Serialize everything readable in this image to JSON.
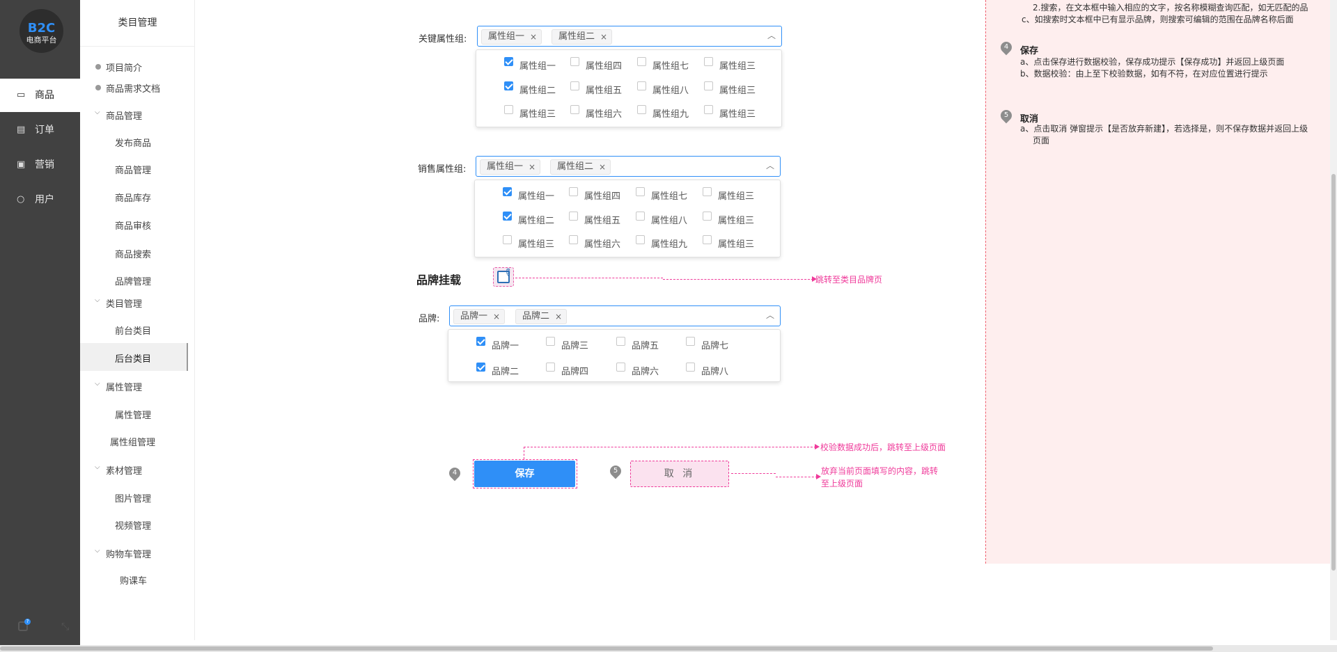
{
  "logo": {
    "main": "B2C",
    "sub": "电商平台"
  },
  "rail": {
    "items": [
      {
        "label": "商品",
        "icon": "bag-icon"
      },
      {
        "label": "订单",
        "icon": "order-icon"
      },
      {
        "label": "营销",
        "icon": "ticket-icon"
      },
      {
        "label": "用户",
        "icon": "user-icon"
      }
    ],
    "active": "商品",
    "badge": "?"
  },
  "menu": {
    "title": "类目管理",
    "doc_items": [
      "项目简介",
      "商品需求文档"
    ],
    "groups": [
      {
        "label": "商品管理",
        "items": [
          "发布商品",
          "商品管理",
          "商品库存",
          "商品审核",
          "商品搜索",
          "品牌管理"
        ]
      },
      {
        "label": "类目管理",
        "items": [
          "前台类目",
          "后台类目"
        ]
      },
      {
        "label": "属性管理",
        "items": [
          "属性管理",
          "属性组管理"
        ]
      },
      {
        "label": "素材管理",
        "items": [
          "图片管理",
          "视频管理"
        ]
      },
      {
        "label": "购物车管理",
        "items": [
          "购课车"
        ]
      }
    ],
    "active_item": "后台类目"
  },
  "form": {
    "key_attr": {
      "label": "关键属性组:",
      "tags": [
        "属性组一",
        "属性组二"
      ],
      "options": [
        [
          "属性组一",
          "属性组四",
          "属性组七",
          "属性组三"
        ],
        [
          "属性组二",
          "属性组五",
          "属性组八",
          "属性组三"
        ],
        [
          "属性组三",
          "属性组六",
          "属性组九",
          "属性组三"
        ]
      ],
      "checked": [
        [
          true,
          false,
          false,
          false
        ],
        [
          true,
          false,
          false,
          false
        ],
        [
          false,
          false,
          false,
          false
        ]
      ]
    },
    "sale_attr": {
      "label": "销售属性组:",
      "tags": [
        "属性组一",
        "属性组二"
      ],
      "options": [
        [
          "属性组一",
          "属性组四",
          "属性组七",
          "属性组三"
        ],
        [
          "属性组二",
          "属性组五",
          "属性组八",
          "属性组三"
        ],
        [
          "属性组三",
          "属性组六",
          "属性组九",
          "属性组三"
        ]
      ],
      "checked": [
        [
          true,
          false,
          false,
          false
        ],
        [
          true,
          false,
          false,
          false
        ],
        [
          false,
          false,
          false,
          false
        ]
      ]
    },
    "brand_section": {
      "heading": "品牌挂载",
      "jump_note": "跳转至类目品牌页"
    },
    "brand": {
      "label": "品牌:",
      "tags": [
        "品牌一",
        "品牌二"
      ],
      "options": [
        [
          "品牌一",
          "品牌三",
          "品牌五",
          "品牌七"
        ],
        [
          "品牌二",
          "品牌四",
          "品牌六",
          "品牌八"
        ]
      ],
      "checked": [
        [
          true,
          false,
          false,
          false
        ],
        [
          true,
          false,
          false,
          false
        ]
      ]
    },
    "save_label": "保存",
    "cancel_label": "取 消",
    "save_note": "校验数据成功后，跳转至上级页面",
    "cancel_note_1": "放弃当前页面填写的内容，跳转",
    "cancel_note_2": "至上级页面",
    "pin_save": "4",
    "pin_cancel": "5"
  },
  "notes": {
    "line_top_1": "2.搜索，在文本框中输入相应的文字，按名称模糊查询匹配，如无匹配的品",
    "line_top_2": "c、如搜索时文本框中已有显示品牌，则搜索可编辑的范围在品牌名称后面",
    "save": {
      "num": "4",
      "title": "保存",
      "a": "a、点击保存进行数据校验，保存成功提示【保存成功】并返回上级页面",
      "b": "b、数据校验：由上至下校验数据，如有不符，在对应位置进行提示"
    },
    "cancel": {
      "num": "5",
      "title": "取消",
      "a": "a、点击取消 弹窗提示【是否放弃新建】，若选择是，则不保存数据并返回上级",
      "a2": "页面"
    }
  },
  "colors": {
    "accent": "#2f8ff7",
    "annotation": "#ef3a9a",
    "rail": "#414141",
    "note_bg": "#feeeee"
  }
}
